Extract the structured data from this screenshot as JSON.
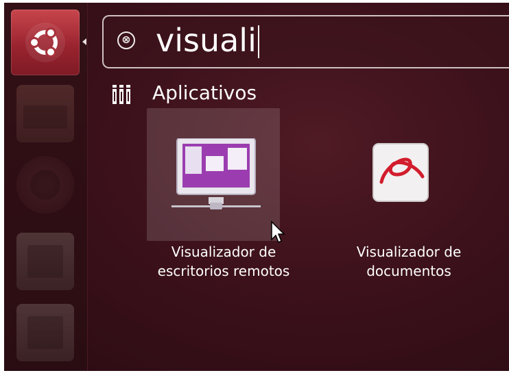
{
  "search": {
    "query": "visuali",
    "clear_icon_glyph": "⊗"
  },
  "launcher": {
    "items": [
      {
        "name": "dash-home",
        "icon": "ubuntu-logo-icon"
      },
      {
        "name": "files",
        "icon": "file-cabinet-icon"
      },
      {
        "name": "firefox",
        "icon": "firefox-icon"
      },
      {
        "name": "libreoffice-writer",
        "icon": "writer-document-icon"
      },
      {
        "name": "libreoffice-calc",
        "icon": "calc-spreadsheet-icon"
      }
    ]
  },
  "category": {
    "label": "Aplicativos",
    "icon": "applications-category-icon"
  },
  "results": [
    {
      "label_line1": "Visualizador de",
      "label_line2": "escritorios remotos",
      "icon": "remote-desktop-monitor-icon",
      "highlighted": true
    },
    {
      "label_line1": "Visualizador de",
      "label_line2": "documentos",
      "icon": "document-viewer-icon",
      "highlighted": false
    }
  ],
  "colors": {
    "accent": "#9a2430",
    "background": "#3c111b",
    "text": "#ffffff"
  }
}
